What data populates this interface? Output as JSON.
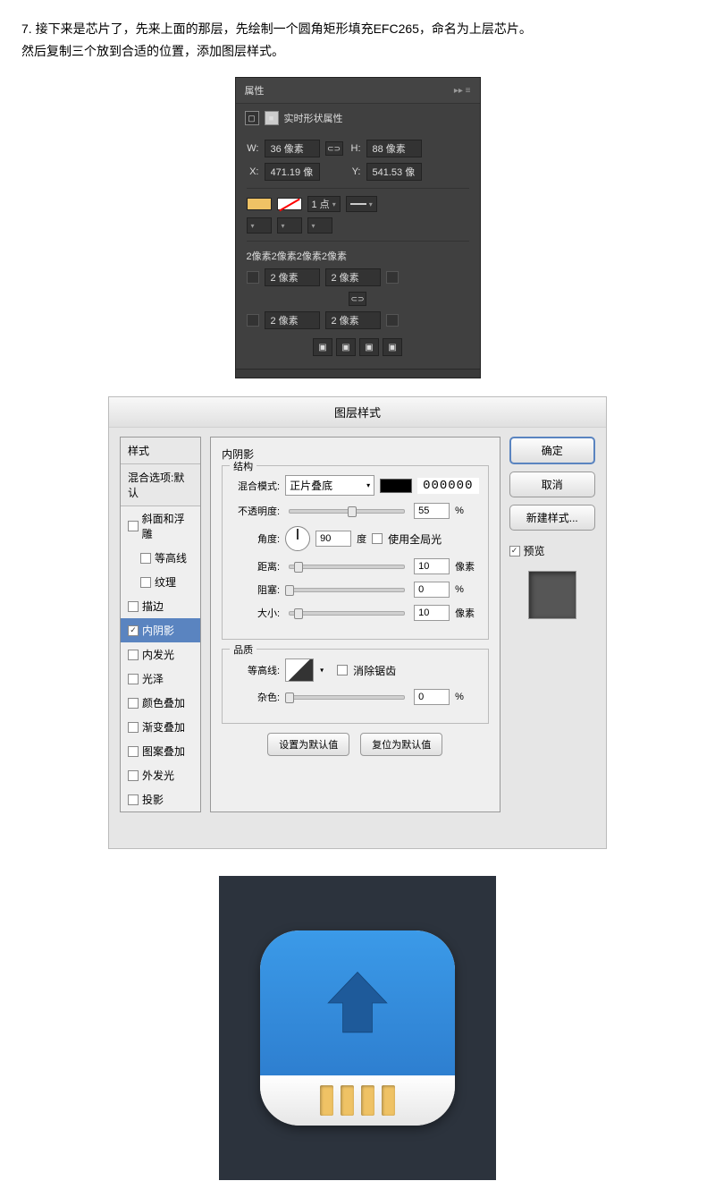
{
  "instruction": {
    "line1": "7. 接下来是芯片了，先来上面的那层，先绘制一个圆角矩形填充EFC265，命名为上层芯片。",
    "line2": "然后复制三个放到合适的位置，添加图层样式。"
  },
  "props": {
    "title": "属性",
    "subtitle": "实时形状属性",
    "w_label": "W:",
    "w_value": "36 像素",
    "h_label": "H:",
    "h_value": "88 像素",
    "x_label": "X:",
    "x_value": "471.19 像",
    "y_label": "Y:",
    "y_value": "541.53 像",
    "stroke_width": "1 点",
    "corners_summary": "2像素2像素2像素2像素",
    "corner_val": "2 像素"
  },
  "layerStyle": {
    "title": "图层样式",
    "left": {
      "header": "样式",
      "blend": "混合选项:默认",
      "items": [
        {
          "label": "斜面和浮雕",
          "checked": false,
          "indent": false
        },
        {
          "label": "等高线",
          "checked": false,
          "indent": true
        },
        {
          "label": "纹理",
          "checked": false,
          "indent": true
        },
        {
          "label": "描边",
          "checked": false,
          "indent": false
        },
        {
          "label": "内阴影",
          "checked": true,
          "indent": false,
          "selected": true
        },
        {
          "label": "内发光",
          "checked": false,
          "indent": false
        },
        {
          "label": "光泽",
          "checked": false,
          "indent": false
        },
        {
          "label": "颜色叠加",
          "checked": false,
          "indent": false
        },
        {
          "label": "渐变叠加",
          "checked": false,
          "indent": false
        },
        {
          "label": "图案叠加",
          "checked": false,
          "indent": false
        },
        {
          "label": "外发光",
          "checked": false,
          "indent": false
        },
        {
          "label": "投影",
          "checked": false,
          "indent": false
        }
      ]
    },
    "mid": {
      "group_title": "内阴影",
      "structure_title": "结构",
      "blend_label": "混合模式:",
      "blend_value": "正片叠底",
      "color_hex": "000000",
      "opacity_label": "不透明度:",
      "opacity_value": "55",
      "percent": "%",
      "angle_label": "角度:",
      "angle_value": "90",
      "deg_unit": "度",
      "global_light": "使用全局光",
      "distance_label": "距离:",
      "distance_value": "10",
      "px_unit": "像素",
      "choke_label": "阻塞:",
      "choke_value": "0",
      "size_label": "大小:",
      "size_value": "10",
      "quality_title": "品质",
      "contour_label": "等高线:",
      "antialias": "消除锯齿",
      "noise_label": "杂色:",
      "noise_value": "0",
      "btn_default": "设置为默认值",
      "btn_reset": "复位为默认值"
    },
    "right": {
      "ok": "确定",
      "cancel": "取消",
      "new_style": "新建样式...",
      "preview": "预览"
    }
  }
}
